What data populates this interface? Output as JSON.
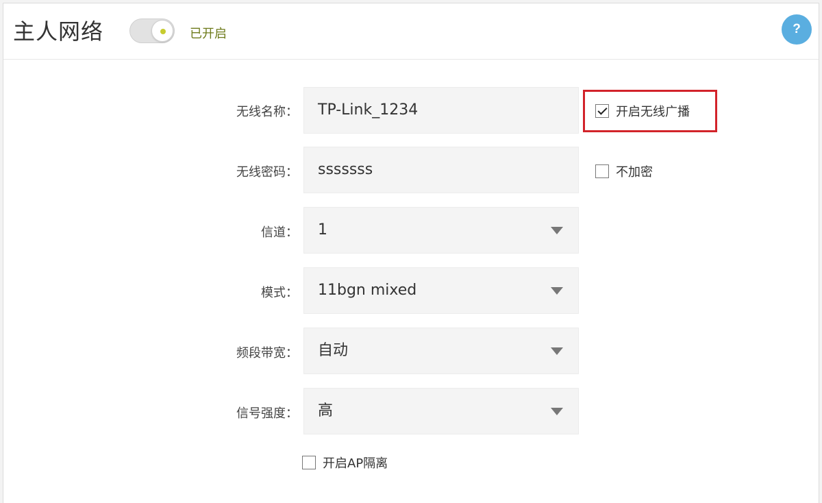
{
  "header": {
    "title": "主人网络",
    "toggle_status": "已开启",
    "toggle_on": true,
    "help_icon_text": "?",
    "help_icon_color": "#5aaee0"
  },
  "form": {
    "ssid": {
      "label": "无线名称：",
      "value": "TP-Link_1234"
    },
    "broadcast": {
      "label": "开启无线广播",
      "checked": true
    },
    "password": {
      "label": "无线密码：",
      "value": "sssssss"
    },
    "no_encrypt": {
      "label": "不加密",
      "checked": false
    },
    "channel": {
      "label": "信道：",
      "value": "1"
    },
    "mode": {
      "label": "模式：",
      "value": "11bgn mixed"
    },
    "bandwidth": {
      "label": "频段带宽：",
      "value": "自动"
    },
    "signal": {
      "label": "信号强度：",
      "value": "高"
    },
    "ap_isolation": {
      "label": "开启AP隔离",
      "checked": false
    }
  },
  "colors": {
    "highlight": "#d2232a",
    "toggle_status": "#6d7a1a"
  }
}
